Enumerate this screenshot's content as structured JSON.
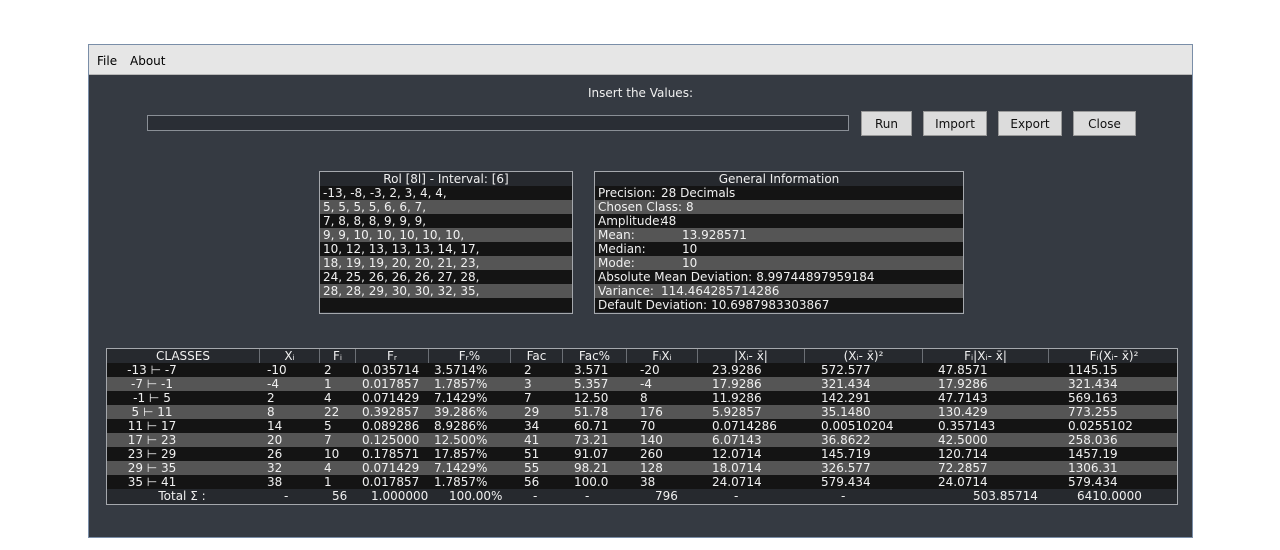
{
  "menu": {
    "file": "File",
    "about": "About"
  },
  "input_section": {
    "label": "Insert the Values:",
    "value": "",
    "placeholder": ""
  },
  "buttons": {
    "run": "Run",
    "import": "Import",
    "export": "Export",
    "close": "Close"
  },
  "rol_panel": {
    "title": "Rol [8l] - Interval: [6]",
    "lines": [
      "-13, -8, -3, 2, 3, 4, 4,",
      "5, 5, 5, 5, 6, 6, 7,",
      "7, 8, 8, 8, 9, 9, 9,",
      "9, 9, 10, 10, 10, 10, 10,",
      "10, 12, 13, 13, 13, 14, 17,",
      "18, 19, 19, 20, 20, 21, 23,",
      "24, 25, 26, 26, 26, 27, 28,",
      "28, 28, 29, 30, 30, 32, 35,",
      ""
    ]
  },
  "info_panel": {
    "title": "General Information",
    "items": [
      {
        "label": "Precision:",
        "value": "28 Decimals"
      },
      {
        "label": "Chosen Class:",
        "value": "8"
      },
      {
        "label": "Amplitude:",
        "value": "48"
      },
      {
        "label": "Mean:",
        "value": "13.928571"
      },
      {
        "label": "Median:",
        "value": "10"
      },
      {
        "label": "Mode:",
        "value": "10"
      },
      {
        "label": "Absolute Mean Deviation:",
        "value": "8.99744897959184"
      },
      {
        "label": "Variance:",
        "value": "114.464285714286"
      },
      {
        "label": "Default Deviation:",
        "value": "10.6987983303867"
      }
    ]
  },
  "frequency_table": {
    "headers": [
      "CLASSES",
      "Xᵢ",
      "Fᵢ",
      "Fᵣ",
      "Fᵣ%",
      "Fac",
      "Fac%",
      "FᵢXᵢ",
      "|Xᵢ- x̄|",
      "(Xᵢ- x̄)²",
      "Fᵢ|Xᵢ- x̄|",
      "Fᵢ(Xᵢ- x̄)²"
    ],
    "rows": [
      [
        "-13 ⊢ -7",
        "-10",
        "2",
        "0.035714",
        "3.5714%",
        "2",
        "3.571",
        "-20",
        "23.9286",
        "572.577",
        "47.8571",
        "1145.15"
      ],
      [
        "-7 ⊢ -1",
        "-4",
        "1",
        "0.017857",
        "1.7857%",
        "3",
        "5.357",
        "-4",
        "17.9286",
        "321.434",
        "17.9286",
        "321.434"
      ],
      [
        "-1 ⊢ 5",
        "2",
        "4",
        "0.071429",
        "7.1429%",
        "7",
        "12.50",
        "8",
        "11.9286",
        "142.291",
        "47.7143",
        "569.163"
      ],
      [
        "5 ⊢ 11",
        "8",
        "22",
        "0.392857",
        "39.286%",
        "29",
        "51.78",
        "176",
        "5.92857",
        "35.1480",
        "130.429",
        "773.255"
      ],
      [
        "11 ⊢ 17",
        "14",
        "5",
        "0.089286",
        "8.9286%",
        "34",
        "60.71",
        "70",
        "0.0714286",
        "0.00510204",
        "0.357143",
        "0.0255102"
      ],
      [
        "17 ⊢ 23",
        "20",
        "7",
        "0.125000",
        "12.500%",
        "41",
        "73.21",
        "140",
        "6.07143",
        "36.8622",
        "42.5000",
        "258.036"
      ],
      [
        "23 ⊢ 29",
        "26",
        "10",
        "0.178571",
        "17.857%",
        "51",
        "91.07",
        "260",
        "12.0714",
        "145.719",
        "120.714",
        "1457.19"
      ],
      [
        "29 ⊢ 35",
        "32",
        "4",
        "0.071429",
        "7.1429%",
        "55",
        "98.21",
        "128",
        "18.0714",
        "326.577",
        "72.2857",
        "1306.31"
      ],
      [
        "35 ⊢ 41",
        "38",
        "1",
        "0.017857",
        "1.7857%",
        "56",
        "100.0",
        "38",
        "24.0714",
        "579.434",
        "24.0714",
        "579.434"
      ]
    ],
    "total_row": [
      "Total Σ :",
      "-",
      "56",
      "1.000000",
      "100.00%",
      "-",
      "-",
      "796",
      "-",
      "-",
      "503.85714",
      "6410.0000"
    ]
  }
}
